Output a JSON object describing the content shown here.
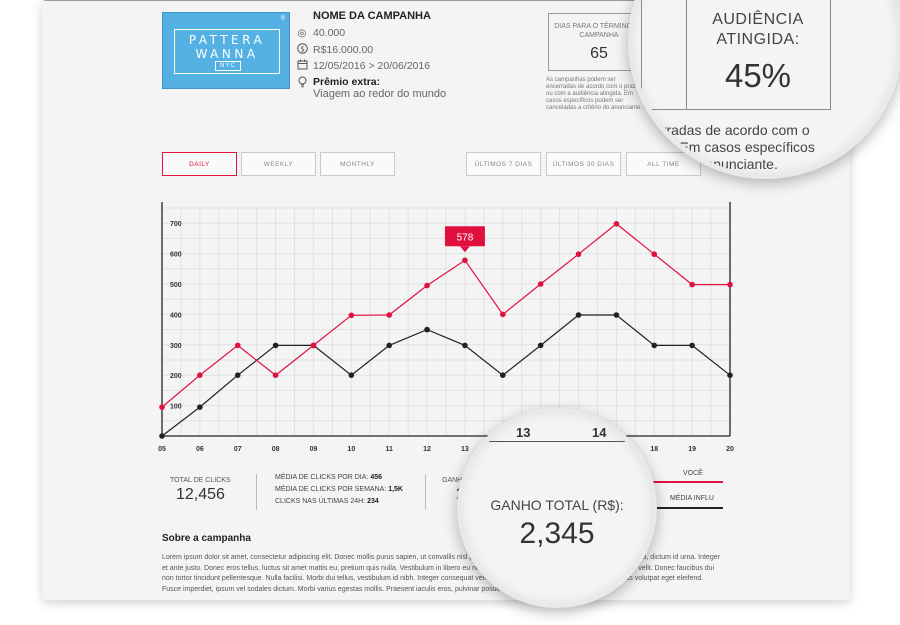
{
  "logo": {
    "line1": "PATTERA",
    "line2": "WANNA",
    "line3": "NYC",
    "reg": "®"
  },
  "campaign": {
    "title": "NOME DA CAMPANHA",
    "reach": "40.000",
    "budget": "R$16.000.00",
    "dates": "12/05/2016 > 20/06/2016",
    "prize_label": "Prêmio extra:",
    "prize_value": "Viagem ao redor do mundo"
  },
  "icons": {
    "reach": "target-icon",
    "budget": "dollar-icon",
    "dates": "calendar-icon",
    "prize": "lightbulb-icon"
  },
  "days_box": {
    "label": "DIAS PARA O TÉRMINO DA CAMPANHA",
    "value": "65"
  },
  "note": "As campanhas podem ser encerradas de acordo com o prazo ou com a audiência atingida. Em casos específicos podem ser canceladas a critério do anunciante.",
  "audience": {
    "label_line1": "AUDIÊNCIA",
    "label_line2": "ATINGIDA:",
    "value": "45%"
  },
  "magnified_note": {
    "line1": "cerradas de acordo com o",
    "line2": "ida. Em casos específicos",
    "line3": "do anunciante."
  },
  "filters": {
    "daily": "DAILY",
    "weekly": "WEEKLY",
    "monthly": "MONTHLY",
    "last7": "ÚLTIMOS 7 DIAS",
    "last30": "ÚLTIMOS 30 DIAS",
    "alltime": "ALL TIME",
    "active": "daily"
  },
  "colors": {
    "accent": "#e0103f",
    "secondary": "#222222",
    "logo": "#55b1e3"
  },
  "chart_data": {
    "type": "line",
    "x": [
      "05",
      "06",
      "07",
      "08",
      "09",
      "10",
      "11",
      "12",
      "13",
      "14",
      "15",
      "16",
      "17",
      "18",
      "19",
      "20"
    ],
    "ylim": [
      0,
      750
    ],
    "yticks": [
      100,
      200,
      300,
      400,
      500,
      600,
      700
    ],
    "grid": true,
    "series": [
      {
        "name": "VOCÊ",
        "color": "#e0103f",
        "values": [
          95,
          200,
          298,
          200,
          298,
          397,
          398,
          495,
          578,
          400,
          500,
          598,
          698,
          598,
          498,
          498
        ]
      },
      {
        "name": "MÉDIA INFLU",
        "color": "#222222",
        "values": [
          0,
          95,
          200,
          298,
          298,
          200,
          298,
          350,
          298,
          200,
          298,
          398,
          398,
          298,
          298,
          200
        ]
      }
    ],
    "annotation": {
      "x": "13",
      "label": "578"
    },
    "magnified_ticks": [
      "13",
      "14"
    ]
  },
  "stats": {
    "total_clicks_label": "TOTAL DE CLICKS",
    "total_clicks_value": "12,456",
    "avg_day_label": "MÉDIA DE CLICKS POR DIA:",
    "avg_day_value": "456",
    "avg_week_label": "MÉDIA DE CLICKS POR SEMANA:",
    "avg_week_value": "1,5K",
    "last24_label": "CLICKS NAS ÚLTIMAS 24H:",
    "last24_value": "234",
    "ganho_partial_label": "GANHO",
    "ganho_partial_value": "2",
    "ganho_label": "GANHO TOTAL (R$):",
    "ganho_value": "2,345"
  },
  "legend": {
    "you": "VOCÊ",
    "avg": "MÉDIA INFLU"
  },
  "about": {
    "title": "Sobre a campanha",
    "text": "Lorem ipsum dolor sit amet, consectetur adipiscing elit. Donec mollis purus sapien, ut convallis nisl pellentesque non. Nulla facilisi. Donec semper vehicula a, dictum id urna. Integer et ante justo. Donec eros tellus, luctus sit amet mattis eu, pretium quis nulla. Vestibulum in libero eu nibh. Curabitur in sem eget eros mattis feugiat at nec velit. Donec faucibus dui non tortor tincidunt pellentesque. Nulla facilisi. Morbi dui tellus, vestibulum id nibh. Integer consequat venenatis porta. Morbi facilisis mi sollicitudin lectus volutpat eget eleifend. Fusce imperdiet, ipsum vel sodales dictum. Morbi varius egestas mollis. Praesent iaculis eros, pulvinar posuere quis."
  }
}
